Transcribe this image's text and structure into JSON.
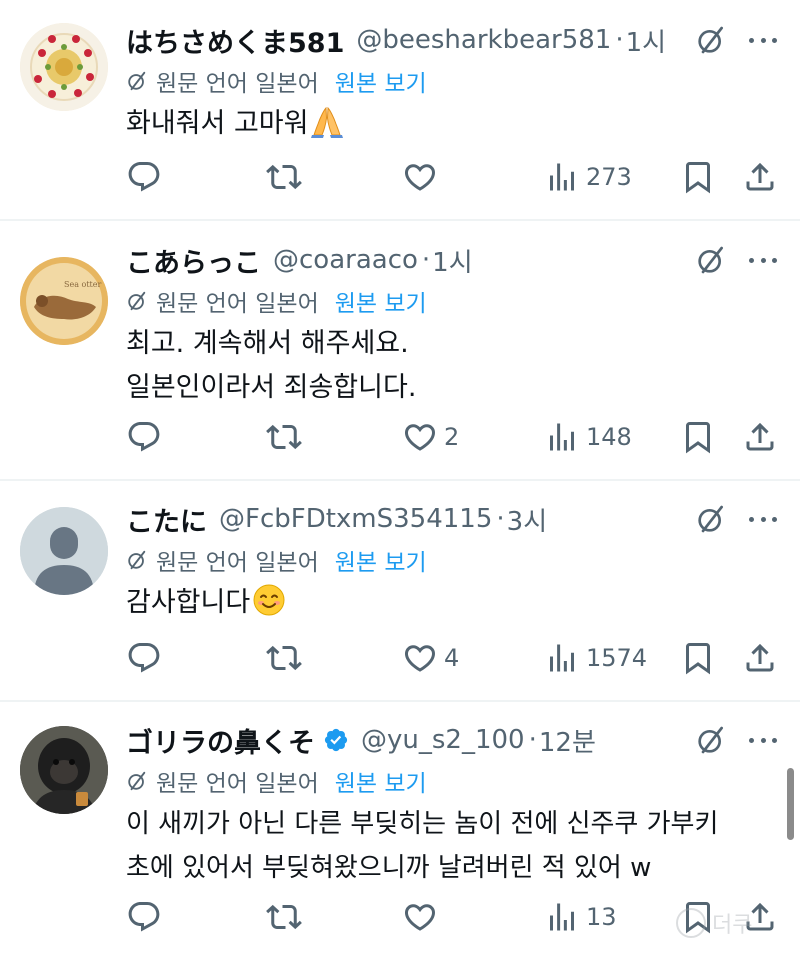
{
  "colors": {
    "text": "#0f1419",
    "secondary": "#536471",
    "link": "#1d9bf0",
    "divider": "#eff3f4",
    "verified": "#1d9bf0"
  },
  "translate": {
    "label": "원문 언어 일본어",
    "view_original": "원본 보기"
  },
  "tweets": [
    {
      "name": "はちさめくま581",
      "handle": "@beesharkbear581",
      "sep": "·",
      "time": "1시",
      "verified": false,
      "avatar": "cake-avatar",
      "text": [
        "화내줘서 고마워"
      ],
      "emoji": "folded-hands",
      "replies": "",
      "retweets": "",
      "likes": "",
      "views": "273"
    },
    {
      "name": "こあらっこ",
      "handle": "@coaraaco",
      "sep": "·",
      "time": "1시",
      "verified": false,
      "avatar": "cookie-avatar",
      "text": [
        "최고. 계속해서 해주세요.",
        "일본인이라서 죄송합니다."
      ],
      "replies": "",
      "retweets": "",
      "likes": "2",
      "views": "148"
    },
    {
      "name": "こたに",
      "handle": "@FcbFDtxmS354115",
      "sep": "·",
      "time": "3시",
      "verified": false,
      "avatar": "default-avatar",
      "text": [
        "감사합니다"
      ],
      "emoji": "smiling-face",
      "replies": "",
      "retweets": "",
      "likes": "4",
      "views": "1574"
    },
    {
      "name": "ゴリラの鼻くそ",
      "handle": "@yu_s2_100",
      "sep": "·",
      "time": "12분",
      "verified": true,
      "avatar": "gorilla-avatar",
      "text": [
        "이 새끼가 아닌 다른 부딪히는 놈이 전에 신주쿠 가부키",
        "초에 있어서 부딪혀왔으니까 날려버린 적 있어 w"
      ],
      "replies": "",
      "retweets": "",
      "likes": "",
      "views": "13"
    }
  ]
}
